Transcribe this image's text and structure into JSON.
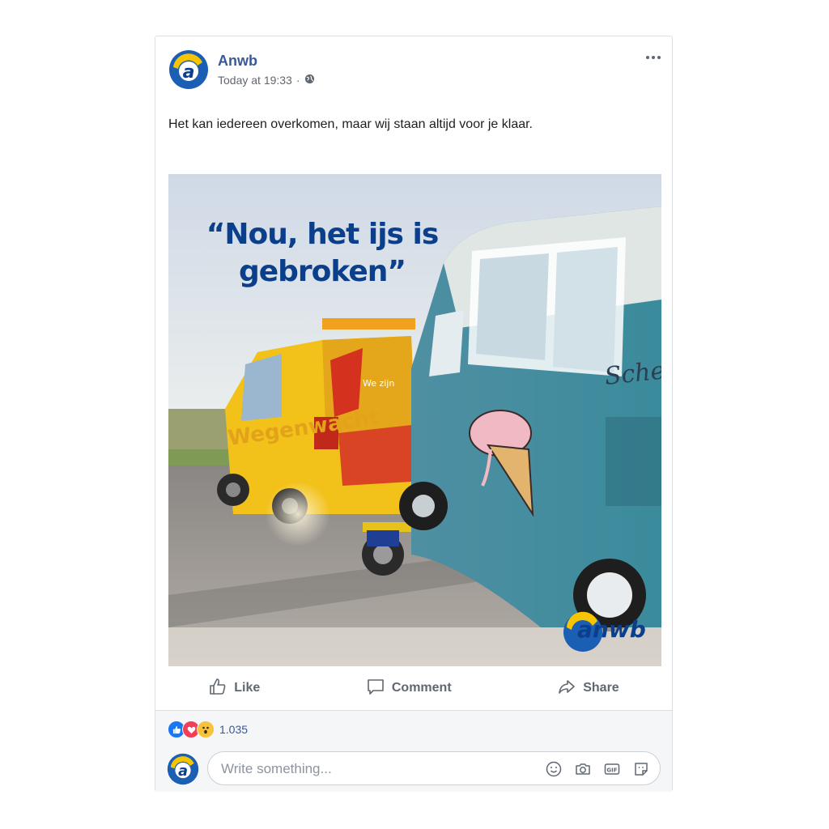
{
  "post": {
    "page_name": "Anwb",
    "timestamp": "Today at 19:33",
    "separator": "·",
    "privacy_icon": "globe-icon",
    "more_icon": "more-options-icon",
    "text": "Het kan iedereen overkomen, maar wij staan altijd voor je klaar.",
    "image": {
      "quote_line1": "“Nou, het ijs is",
      "quote_line2": "gebroken”",
      "van_lettering": "Wegenwacht",
      "van_slogan": "We zijn",
      "bus_lettering": "Schepijs",
      "logo_text": "anwb"
    }
  },
  "actions": {
    "like_label": "Like",
    "comment_label": "Comment",
    "share_label": "Share"
  },
  "reactions": {
    "types": [
      "like-icon",
      "love-icon",
      "wow-icon"
    ],
    "count": "1.035"
  },
  "comment": {
    "placeholder": "Write something...",
    "tools": [
      "emoji-icon",
      "camera-icon",
      "gif-icon",
      "sticker-icon"
    ]
  },
  "colors": {
    "brand_blue": "#0b3f8c",
    "anwb_yellow": "#f6c400",
    "link_blue": "#385898",
    "like_blue": "#1877f2",
    "love_red": "#f33e58"
  }
}
